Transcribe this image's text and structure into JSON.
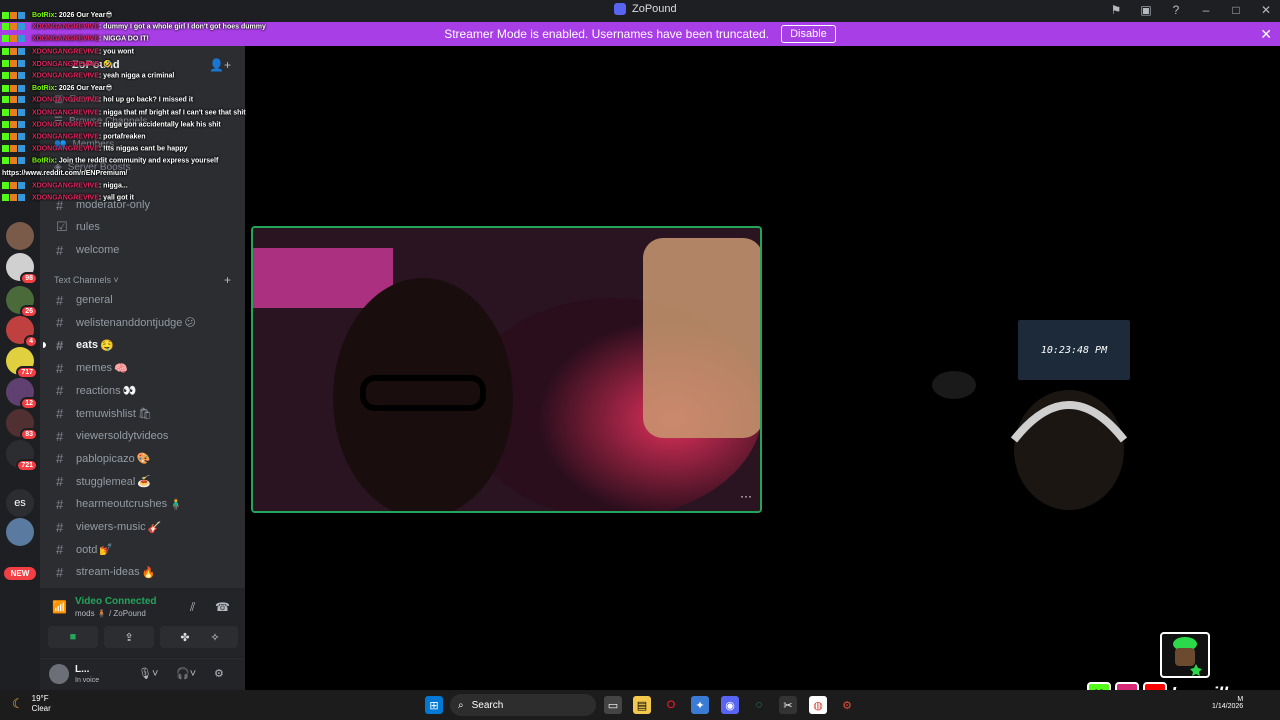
{
  "window": {
    "title": "ZoPound"
  },
  "banner": {
    "message": "Streamer Mode is enabled. Usernames have been truncated.",
    "disable_label": "Disable"
  },
  "servers": [
    {
      "badge": "",
      "color": "#7a5a48"
    },
    {
      "badge": "98",
      "color": "#d0d0d0"
    },
    {
      "badge": "26",
      "color": "#4a6a3a"
    },
    {
      "badge": "4",
      "color": "#c04040"
    },
    {
      "badge": "717",
      "color": "#e0d040"
    },
    {
      "badge": "12",
      "color": "#604070"
    },
    {
      "badge": "83",
      "color": "#503030"
    },
    {
      "badge": "721",
      "color": "#2b2d31"
    },
    {
      "badge": "",
      "color": "#5a7aa0"
    }
  ],
  "server_es": "es",
  "new_badge": "NEW",
  "server": {
    "name": "ZoPound",
    "menu": {
      "events": "Events",
      "browse": "Browse Channels",
      "members": "Members",
      "boosts": "Server Boosts"
    },
    "top_channels": [
      "moderator-only",
      "rules",
      "welcome"
    ],
    "category": "Text Channels",
    "channels": [
      {
        "name": "general",
        "emoji": ""
      },
      {
        "name": "welistenanddontjudge",
        "emoji": "😕"
      },
      {
        "name": "eats",
        "emoji": "🤤"
      },
      {
        "name": "memes",
        "emoji": "🧠"
      },
      {
        "name": "reactions",
        "emoji": "👀"
      },
      {
        "name": "temuwishlist",
        "emoji": "🛍"
      },
      {
        "name": "viewersoldytvideos",
        "emoji": ""
      },
      {
        "name": "pablopicazo",
        "emoji": "🎨"
      },
      {
        "name": "stugglemeal",
        "emoji": "🍝"
      },
      {
        "name": "hearmeoutcrushes",
        "emoji": "🧍‍♂️"
      },
      {
        "name": "viewers-music",
        "emoji": "🎸"
      },
      {
        "name": "ootd",
        "emoji": "💅"
      },
      {
        "name": "stream-ideas",
        "emoji": "🔥"
      }
    ]
  },
  "voice": {
    "status": "Video Connected",
    "location": "mods 🧍🏽 / ZoPound"
  },
  "user": {
    "name": "L...",
    "status": "In voice"
  },
  "chat": [
    {
      "user": "BotRix",
      "bot": true,
      "msg": ": 2026 Our Year😎"
    },
    {
      "user": "XDONGANGREVIVE",
      "bot": false,
      "msg": ": dummy I got a whole girl I don't got hoes dummy"
    },
    {
      "user": "XDONGANGREVIVE",
      "bot": false,
      "msg": ": NIGGA DO IT!"
    },
    {
      "user": "XDONGANGREVIVE",
      "bot": false,
      "msg": ": you wont"
    },
    {
      "user": "XDONGANGREVIVE",
      "bot": false,
      "msg": ": 🤣"
    },
    {
      "user": "XDONGANGREVIVE",
      "bot": false,
      "msg": ": yeah nigga a criminal"
    },
    {
      "user": "BotRix",
      "bot": true,
      "msg": ": 2026 Our Year😎"
    },
    {
      "user": "XDONGANGREVIVE",
      "bot": false,
      "msg": ": hol up go back? I missed it"
    },
    {
      "user": "XDONGANGREVIVE",
      "bot": false,
      "msg": ": nigga that mf bright asf I can't see that shit"
    },
    {
      "user": "XDONGANGREVIVE",
      "bot": false,
      "msg": ": nigga gon accidentally leak his shit"
    },
    {
      "user": "XDONGANGREVIVE",
      "bot": false,
      "msg": ": portafreaken"
    },
    {
      "user": "XDONGANGREVIVE",
      "bot": false,
      "msg": ": !tts niggas cant be happy"
    },
    {
      "user": "BotRix",
      "bot": true,
      "msg": ": Join the reddit community and express yourself"
    },
    {
      "user": "",
      "bot": false,
      "msg": "https://www.reddit.com/r/ENPremium/"
    },
    {
      "user": "XDONGANGREVIVE",
      "bot": false,
      "msg": ": nigga..."
    },
    {
      "user": "XDONGANGREVIVE",
      "bot": false,
      "msg": ": yall got it"
    }
  ],
  "camera": {
    "clock_text": "10:23:48 PM"
  },
  "streamer": {
    "name": "Lonzilly",
    "socials": [
      "kick-icon",
      "instagram-icon",
      "youtube-icon"
    ]
  },
  "taskbar": {
    "weather_temp": "19°F",
    "weather_desc": "Clear",
    "search_placeholder": "Search",
    "date": "1/14/2026",
    "time_suffix": "M"
  },
  "colors": {
    "discord_green": "#23a55a",
    "streamer_banner": "#a83ee6",
    "badge_red": "#f23f43"
  }
}
